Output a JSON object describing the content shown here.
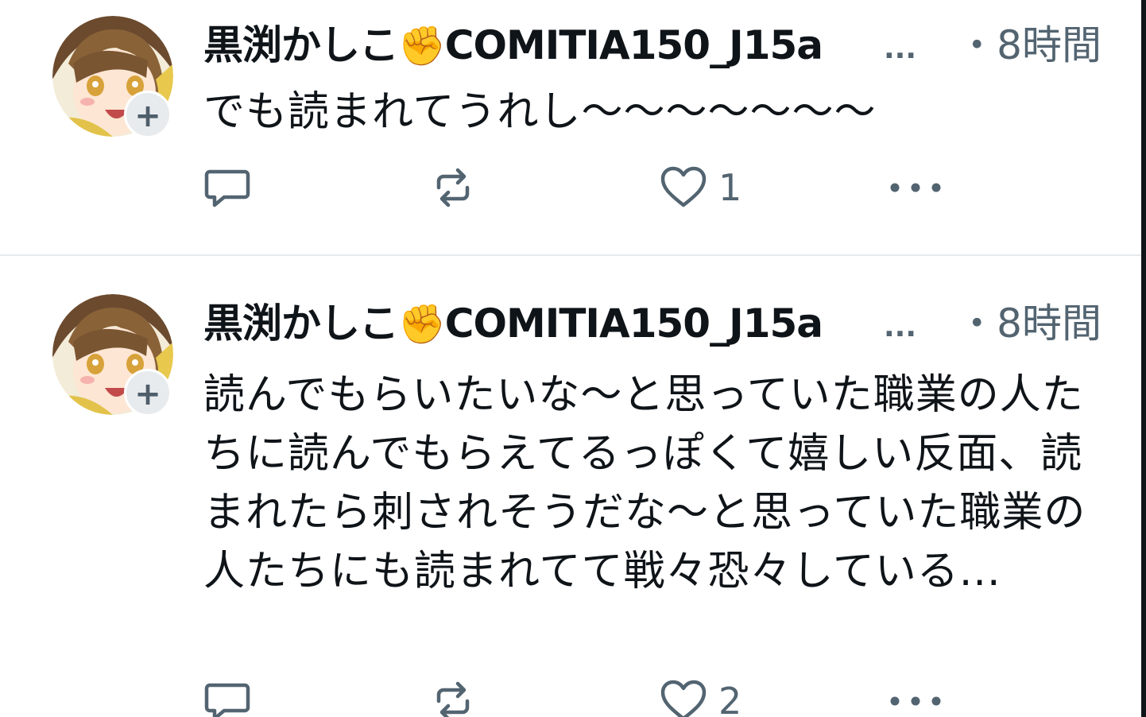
{
  "tweets": [
    {
      "author": "黒渕かしこ",
      "author_emoji": "✊",
      "handle": "COMITIA150_J15a",
      "handle_ellipsis": "...",
      "time": "・8時間",
      "text": "でも読まれてうれし〜〜〜〜〜〜〜",
      "reply_count": "",
      "retweet_count": "",
      "like_count": "1",
      "follow_symbol": "+",
      "icons": [
        "reply-icon",
        "retweet-icon",
        "heart-icon",
        "more-icon"
      ]
    },
    {
      "author": "黒渕かしこ",
      "author_emoji": "✊",
      "handle": "COMITIA150_J15a",
      "handle_ellipsis": "...",
      "time": "・8時間",
      "text": "読んでもらいたいな〜と思っていた職業の人たちに読んでもらえてるっぽくて嬉しい反面、読まれたら刺されそうだな〜と思っていた職業の人たちにも読まれてて戦々恐々している...",
      "reply_count": "",
      "retweet_count": "",
      "like_count": "2",
      "follow_symbol": "+",
      "icons": [
        "reply-icon",
        "retweet-icon",
        "heart-icon",
        "more-icon"
      ]
    }
  ],
  "colors": {
    "text_primary": "#0f1419",
    "text_secondary": "#536471",
    "divider": "#e6eaed",
    "badge_bg": "#e8ebee"
  }
}
